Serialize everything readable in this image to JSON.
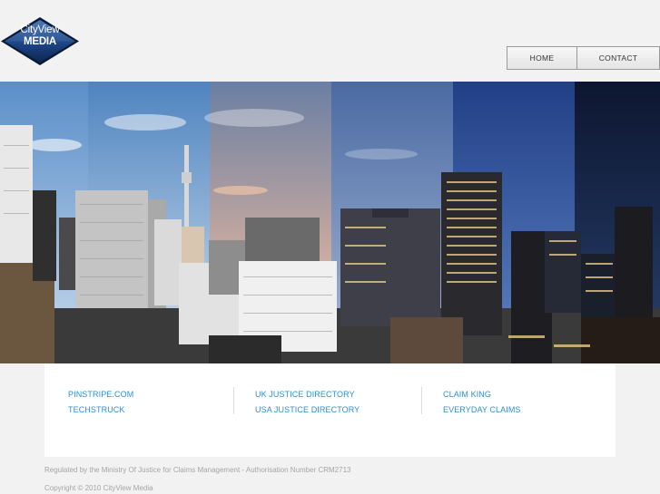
{
  "logo": {
    "line1": "CityView",
    "line2": "MEDIA",
    "colors": {
      "fill": "#1d3f78",
      "border": "#0d1d3a"
    }
  },
  "nav": {
    "home": "HOME",
    "contact": "CONTACT"
  },
  "hero": {
    "description_icon": "city-skyline-banner"
  },
  "links": {
    "col1": [
      "PINSTRIPE.COM",
      "TECHSTRUCK"
    ],
    "col2": [
      "UK JUSTICE DIRECTORY",
      "USA JUSTICE DIRECTORY"
    ],
    "col3": [
      "CLAIM KING",
      "EVERYDAY CLAIMS"
    ],
    "color": "#2b8fd3"
  },
  "footer": {
    "regulated": "Regulated by the Ministry Of Justice for Claims Management - Authorisation Number CRM2713",
    "copyright": "Copyright © 2010 CityView Media"
  }
}
